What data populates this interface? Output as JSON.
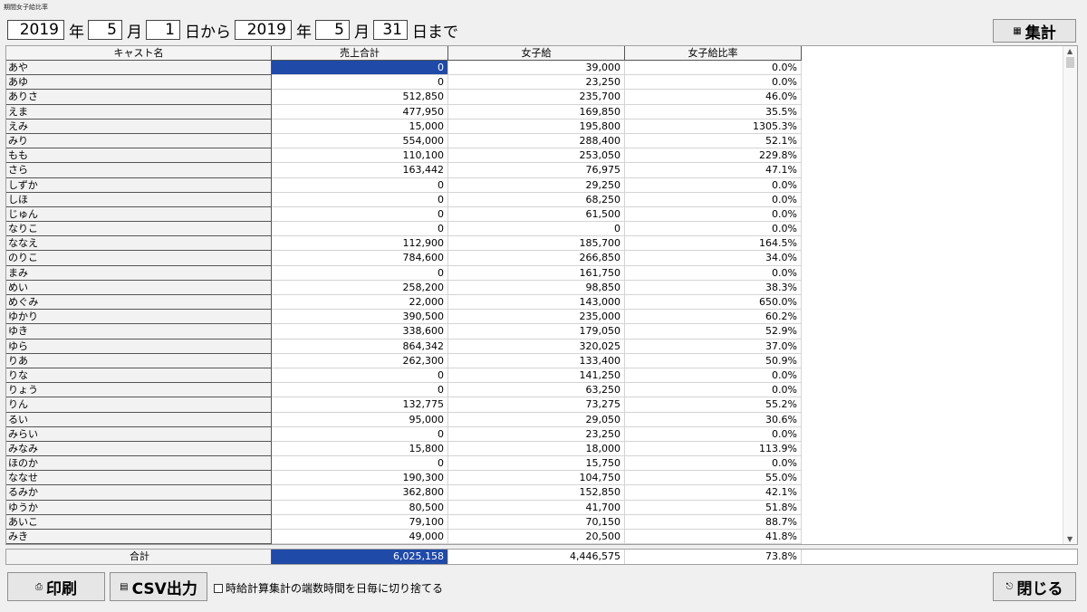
{
  "window": {
    "title": "期間女子給比率"
  },
  "date_range": {
    "from_year": "2019",
    "year_label": "年",
    "from_month": "5",
    "month_label": "月",
    "from_day": "1",
    "from_suffix": "日から",
    "to_year": "2019",
    "to_month": "5",
    "to_day": "31",
    "to_suffix": "日まで"
  },
  "buttons": {
    "aggregate": "集計",
    "print": "印刷",
    "csv": "CSV出力",
    "close": "閉じる"
  },
  "icons": {
    "aggregate": "calculator-icon",
    "print": "printer-icon",
    "csv": "csv-export-icon",
    "close": "door-exit-icon"
  },
  "table": {
    "columns": [
      "キャスト名",
      "売上合計",
      "女子給",
      "女子給比率"
    ],
    "rows": [
      [
        "あや",
        "0",
        "39,000",
        "0.0%"
      ],
      [
        "あゆ",
        "0",
        "23,250",
        "0.0%"
      ],
      [
        "ありさ",
        "512,850",
        "235,700",
        "46.0%"
      ],
      [
        "えま",
        "477,950",
        "169,850",
        "35.5%"
      ],
      [
        "えみ",
        "15,000",
        "195,800",
        "1305.3%"
      ],
      [
        "みり",
        "554,000",
        "288,400",
        "52.1%"
      ],
      [
        "もも",
        "110,100",
        "253,050",
        "229.8%"
      ],
      [
        "さら",
        "163,442",
        "76,975",
        "47.1%"
      ],
      [
        "しずか",
        "0",
        "29,250",
        "0.0%"
      ],
      [
        "しほ",
        "0",
        "68,250",
        "0.0%"
      ],
      [
        "じゅん",
        "0",
        "61,500",
        "0.0%"
      ],
      [
        "なりこ",
        "0",
        "0",
        "0.0%"
      ],
      [
        "ななえ",
        "112,900",
        "185,700",
        "164.5%"
      ],
      [
        "のりこ",
        "784,600",
        "266,850",
        "34.0%"
      ],
      [
        "まみ",
        "0",
        "161,750",
        "0.0%"
      ],
      [
        "めい",
        "258,200",
        "98,850",
        "38.3%"
      ],
      [
        "めぐみ",
        "22,000",
        "143,000",
        "650.0%"
      ],
      [
        "ゆかり",
        "390,500",
        "235,000",
        "60.2%"
      ],
      [
        "ゆき",
        "338,600",
        "179,050",
        "52.9%"
      ],
      [
        "ゆら",
        "864,342",
        "320,025",
        "37.0%"
      ],
      [
        "りあ",
        "262,300",
        "133,400",
        "50.9%"
      ],
      [
        "りな",
        "0",
        "141,250",
        "0.0%"
      ],
      [
        "りょう",
        "0",
        "63,250",
        "0.0%"
      ],
      [
        "りん",
        "132,775",
        "73,275",
        "55.2%"
      ],
      [
        "るい",
        "95,000",
        "29,050",
        "30.6%"
      ],
      [
        "みらい",
        "0",
        "23,250",
        "0.0%"
      ],
      [
        "みなみ",
        "15,800",
        "18,000",
        "113.9%"
      ],
      [
        "ほのか",
        "0",
        "15,750",
        "0.0%"
      ],
      [
        "ななせ",
        "190,300",
        "104,750",
        "55.0%"
      ],
      [
        "るみか",
        "362,800",
        "152,850",
        "42.1%"
      ],
      [
        "ゆうか",
        "80,500",
        "41,700",
        "51.8%"
      ],
      [
        "あいこ",
        "79,100",
        "70,150",
        "88.7%"
      ],
      [
        "みき",
        "49,000",
        "20,500",
        "41.8%"
      ]
    ],
    "total": [
      "合計",
      "6,025,158",
      "4,446,575",
      "73.8%"
    ]
  },
  "options": {
    "truncate_label": "時給計算集計の端数時間を日毎に切り捨てる",
    "truncate_checked": false
  },
  "colors": {
    "selection": "#1f4aa8",
    "background": "#f0f0f0"
  }
}
